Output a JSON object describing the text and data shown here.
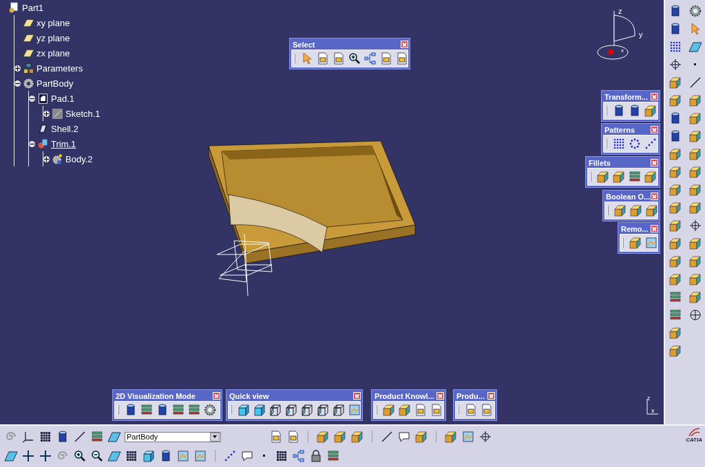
{
  "tree": {
    "label": "Part1",
    "kind": "part",
    "current": false,
    "children": [
      {
        "label": "xy plane",
        "kind": "plane",
        "current": false
      },
      {
        "label": "yz plane",
        "kind": "plane",
        "current": false
      },
      {
        "label": "zx plane",
        "kind": "plane",
        "current": false
      },
      {
        "label": "Parameters",
        "kind": "parameters",
        "current": false,
        "expanded": false
      },
      {
        "label": "PartBody",
        "kind": "body",
        "current": false,
        "expanded": true,
        "children": [
          {
            "label": "Pad.1",
            "kind": "pad",
            "current": false,
            "expanded": true,
            "children": [
              {
                "label": "Sketch.1",
                "kind": "sketch",
                "current": false,
                "expanded": false
              }
            ]
          },
          {
            "label": "Shell.2",
            "kind": "shell",
            "current": false
          },
          {
            "label": "Trim.1",
            "kind": "trim",
            "current": true,
            "expanded": true,
            "children": [
              {
                "label": "Body.2",
                "kind": "body2",
                "current": false,
                "expanded": false
              }
            ]
          }
        ]
      }
    ]
  },
  "floating_toolbars": [
    {
      "title": "Select"
    },
    {
      "title": "Transform..."
    },
    {
      "title": "Patterns"
    },
    {
      "title": "Fillets"
    },
    {
      "title": "Boolean O..."
    },
    {
      "title": "Remo..."
    },
    {
      "title": "2D Visualization Mode"
    },
    {
      "title": "Quick view"
    },
    {
      "title": "Product Knowl..."
    },
    {
      "title": "Produ..."
    }
  ],
  "compass_labels": [
    "z",
    "y",
    "x"
  ],
  "triad_labels": [
    "z",
    "x"
  ],
  "body_selector": {
    "value": "PartBody"
  },
  "logo": {
    "text": "CATIA"
  }
}
